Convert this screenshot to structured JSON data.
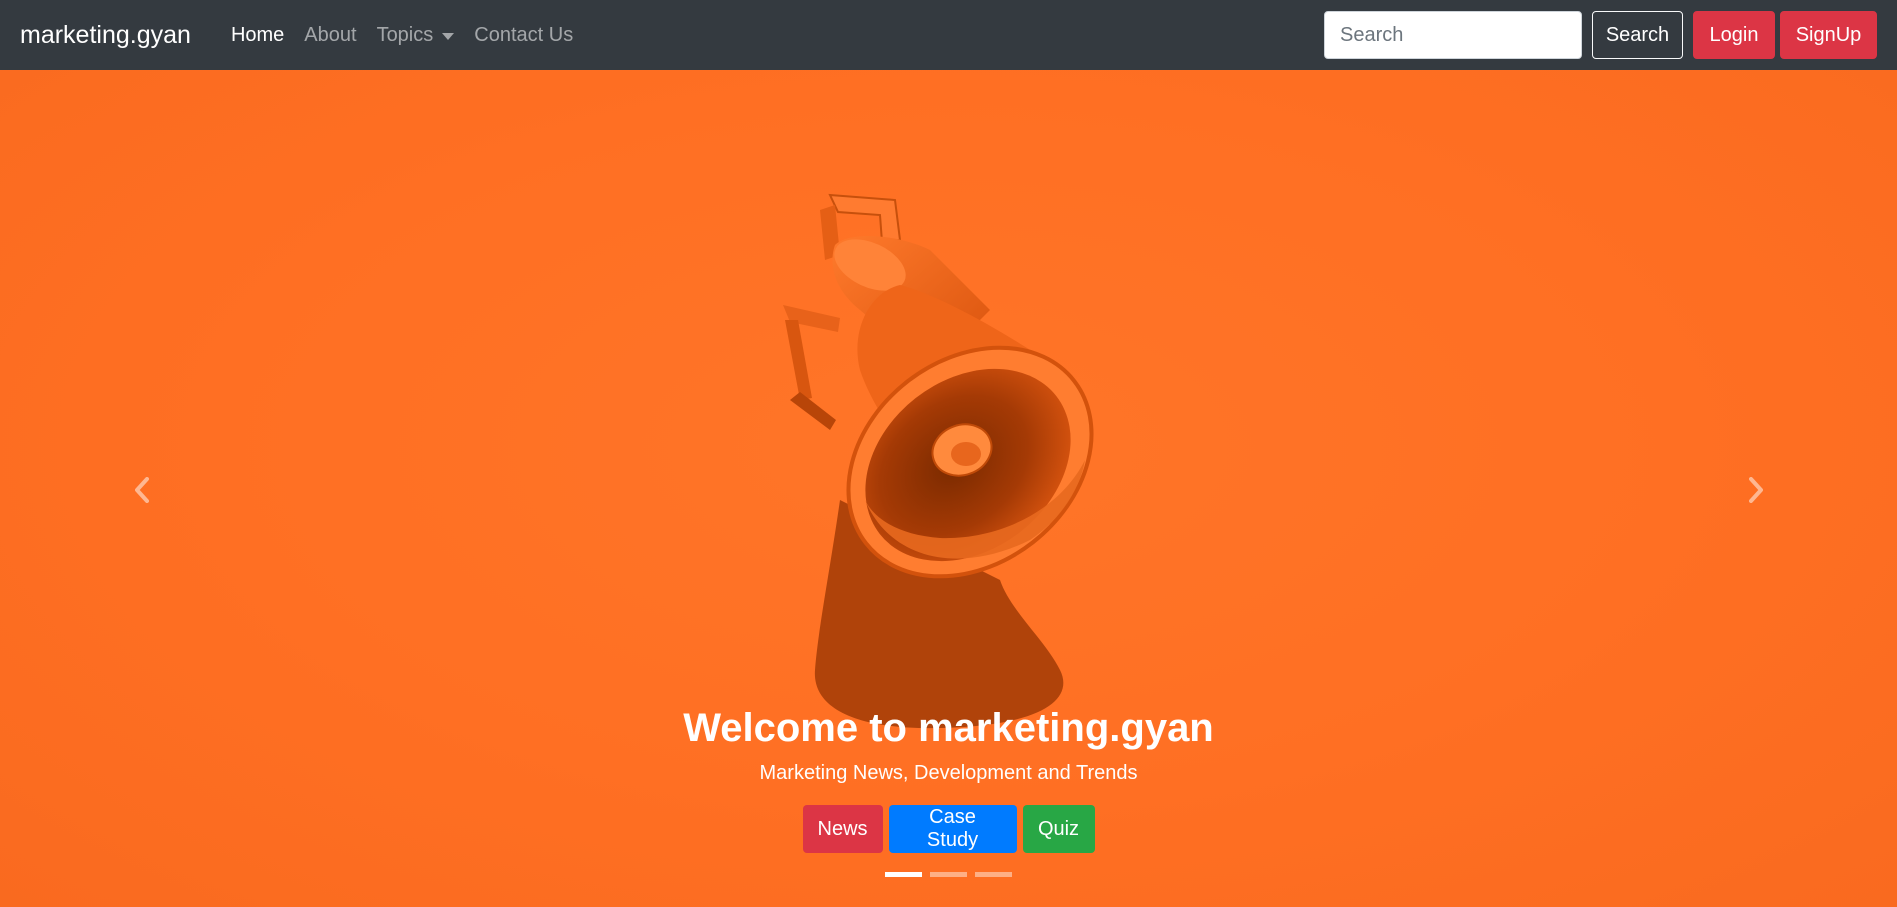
{
  "navbar": {
    "brand": "marketing.gyan",
    "links": [
      {
        "label": "Home"
      },
      {
        "label": "About"
      },
      {
        "label": "Topics"
      },
      {
        "label": "Contact Us"
      }
    ],
    "search": {
      "placeholder": "Search",
      "value": ""
    },
    "search_button": "Search",
    "login_button": "Login",
    "signup_button": "SignUp"
  },
  "hero": {
    "title": "Welcome to marketing.gyan",
    "subtitle": "Marketing News, Development and Trends",
    "buttons": [
      {
        "label": "News",
        "color": "#dc3545"
      },
      {
        "label": "Case Study",
        "color": "#007bff"
      },
      {
        "label": "Quiz",
        "color": "#28a745"
      }
    ],
    "slides_total": 3,
    "active_slide": 1,
    "background_color": "#ff6f25",
    "controls": [
      "chevron-left-icon",
      "chevron-right-icon"
    ]
  }
}
